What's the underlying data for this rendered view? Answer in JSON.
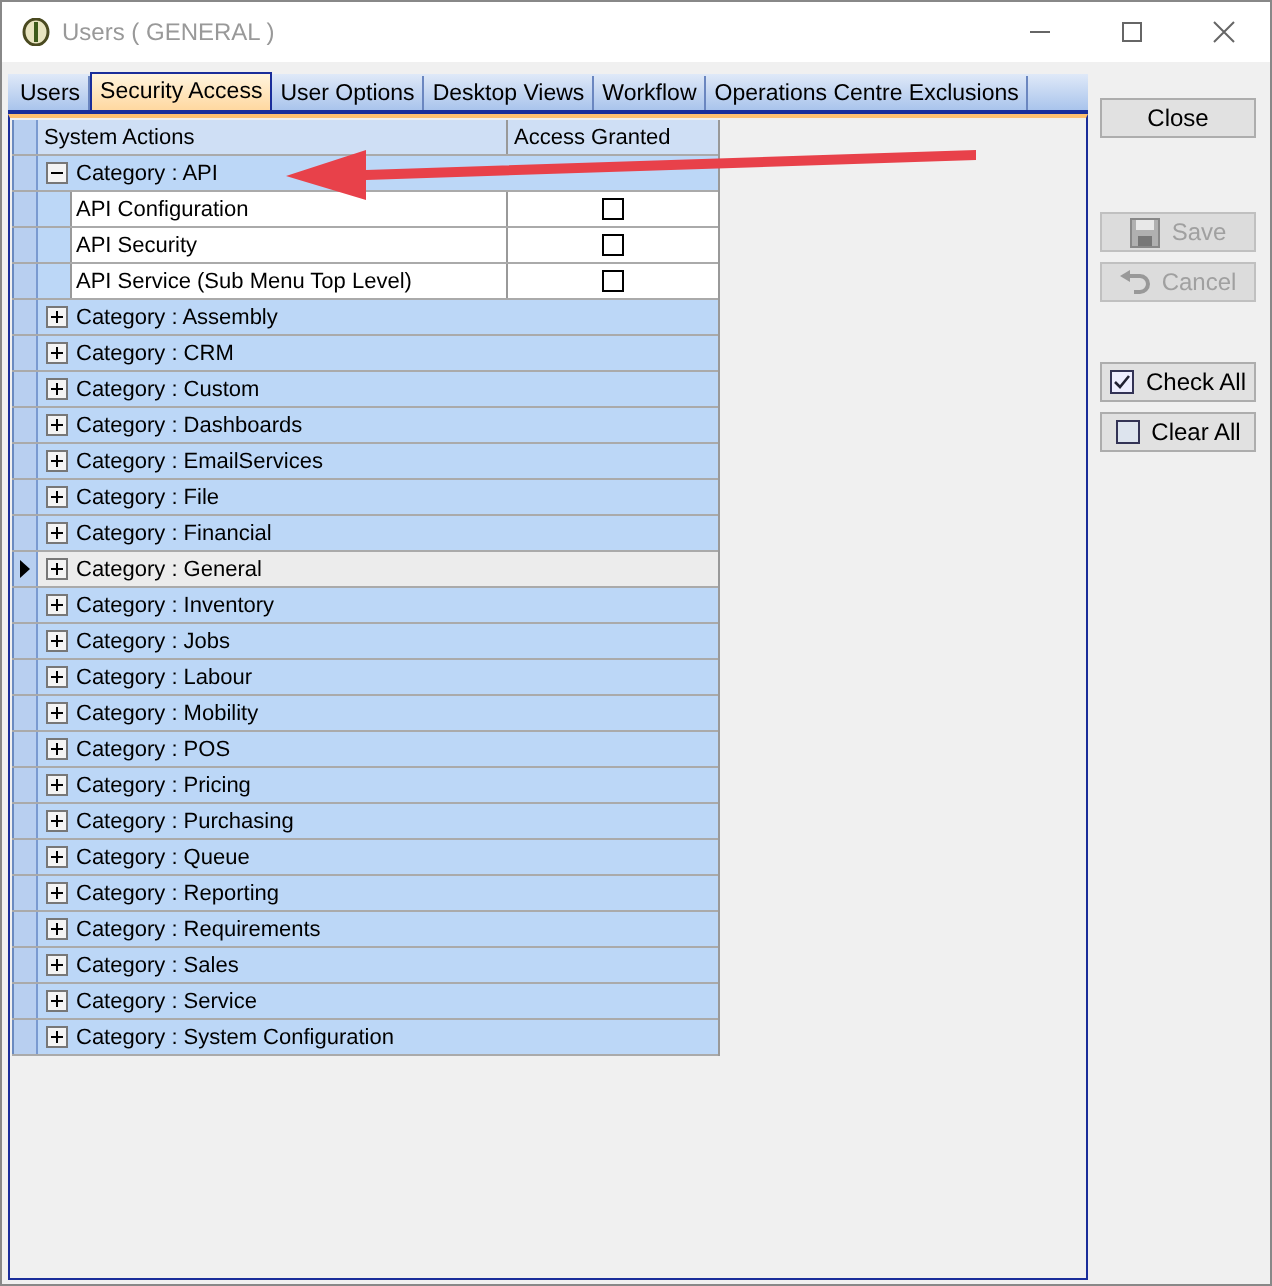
{
  "window": {
    "title": "Users ( GENERAL )"
  },
  "tabs": [
    {
      "label": "Users",
      "selected": false
    },
    {
      "label": "Security Access",
      "selected": true
    },
    {
      "label": "User Options",
      "selected": false
    },
    {
      "label": "Desktop Views",
      "selected": false
    },
    {
      "label": "Workflow",
      "selected": false
    },
    {
      "label": "Operations Centre Exclusions",
      "selected": false
    }
  ],
  "grid": {
    "columns": [
      "System Actions",
      "Access Granted"
    ],
    "rows": [
      {
        "label": "Category : API",
        "expanded": true,
        "selected": false,
        "children": [
          {
            "label": "API Configuration",
            "checked": false
          },
          {
            "label": "API Security",
            "checked": false
          },
          {
            "label": "API Service (Sub Menu Top Level)",
            "checked": false
          }
        ]
      },
      {
        "label": "Category : Assembly",
        "expanded": false,
        "selected": false
      },
      {
        "label": "Category : CRM",
        "expanded": false,
        "selected": false
      },
      {
        "label": "Category : Custom",
        "expanded": false,
        "selected": false
      },
      {
        "label": "Category : Dashboards",
        "expanded": false,
        "selected": false
      },
      {
        "label": "Category : EmailServices",
        "expanded": false,
        "selected": false
      },
      {
        "label": "Category : File",
        "expanded": false,
        "selected": false
      },
      {
        "label": "Category : Financial",
        "expanded": false,
        "selected": false
      },
      {
        "label": "Category : General",
        "expanded": false,
        "selected": true
      },
      {
        "label": "Category : Inventory",
        "expanded": false,
        "selected": false
      },
      {
        "label": "Category : Jobs",
        "expanded": false,
        "selected": false
      },
      {
        "label": "Category : Labour",
        "expanded": false,
        "selected": false
      },
      {
        "label": "Category : Mobility",
        "expanded": false,
        "selected": false
      },
      {
        "label": "Category : POS",
        "expanded": false,
        "selected": false
      },
      {
        "label": "Category : Pricing",
        "expanded": false,
        "selected": false
      },
      {
        "label": "Category : Purchasing",
        "expanded": false,
        "selected": false
      },
      {
        "label": "Category : Queue",
        "expanded": false,
        "selected": false
      },
      {
        "label": "Category : Reporting",
        "expanded": false,
        "selected": false
      },
      {
        "label": "Category : Requirements",
        "expanded": false,
        "selected": false
      },
      {
        "label": "Category : Sales",
        "expanded": false,
        "selected": false
      },
      {
        "label": "Category : Service",
        "expanded": false,
        "selected": false
      },
      {
        "label": "Category : System Configuration",
        "expanded": false,
        "selected": false
      }
    ]
  },
  "buttons": [
    {
      "label": "Close",
      "kind": "plain",
      "disabled": false
    },
    {
      "label": "Save",
      "kind": "save",
      "disabled": true
    },
    {
      "label": "Cancel",
      "kind": "undo",
      "disabled": true
    },
    {
      "label": "Check All",
      "kind": "checkall",
      "disabled": false
    },
    {
      "label": "Clear All",
      "kind": "clearall",
      "disabled": false
    }
  ]
}
